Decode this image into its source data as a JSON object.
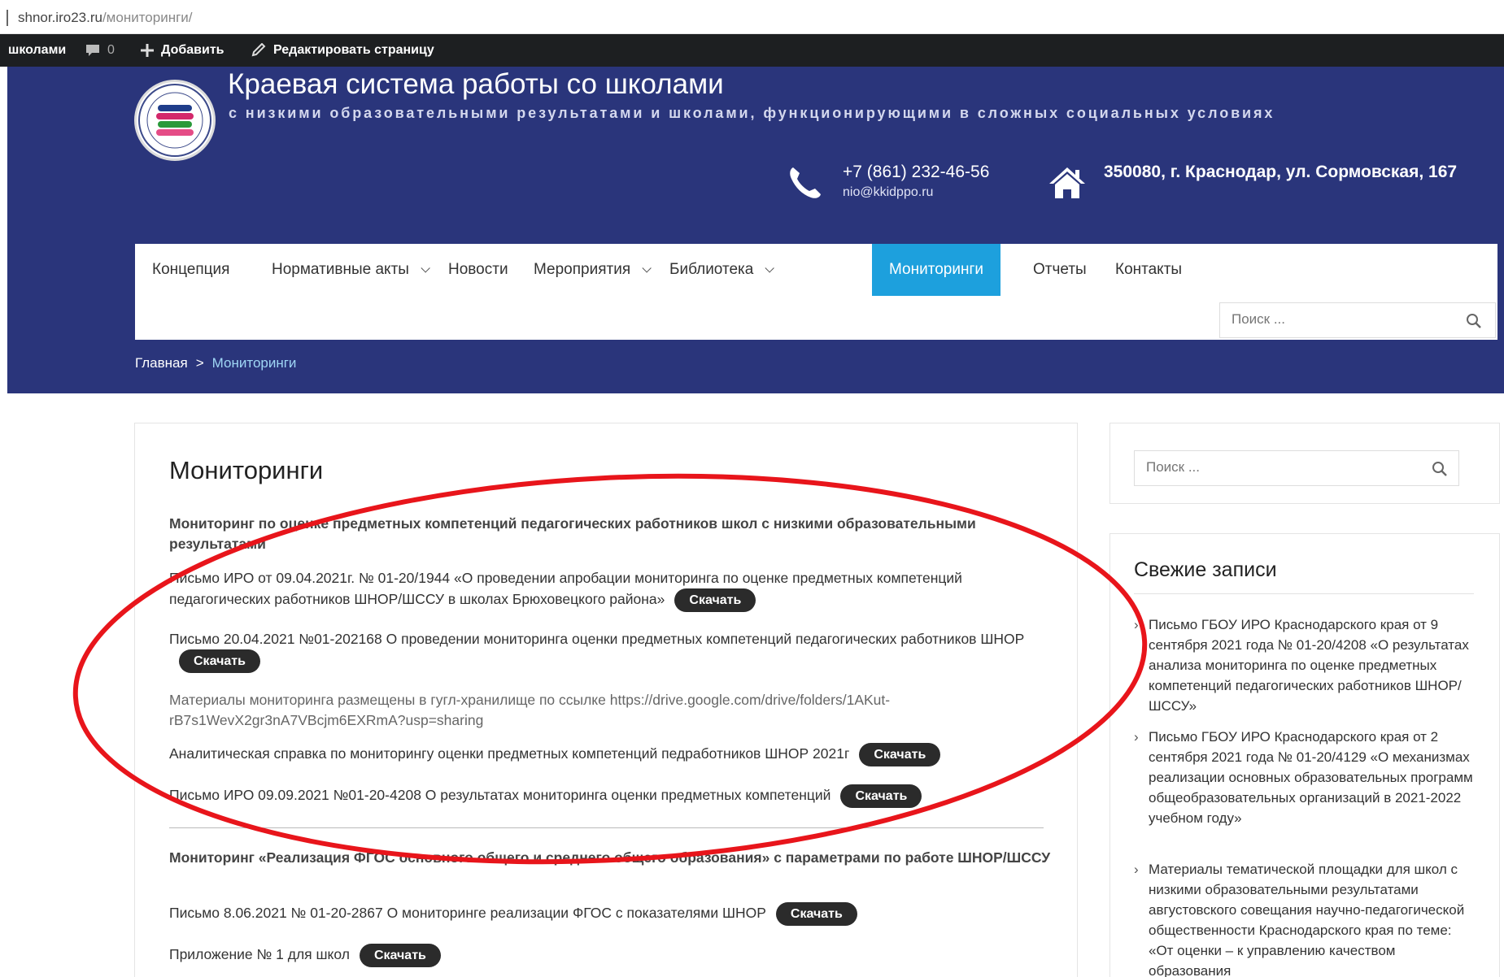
{
  "browser": {
    "url_host": "shnor.iro23.ru",
    "url_path": "/мониторинги/"
  },
  "admin_bar": {
    "site_link": "школами",
    "comments_count": "0",
    "add_label": "Добавить",
    "edit_label": "Редактировать страницу"
  },
  "header": {
    "title": "Краевая система работы со школами",
    "description": "с низкими образовательными результатами и школами, функционирующими в сложных социальных условиях",
    "phone": "+7 (861) 232-46-56",
    "email": "nio@kkidppo.ru",
    "address": "350080, г. Краснодар, ул. Сормовская, 167"
  },
  "nav": {
    "items": [
      {
        "label": "Концепция"
      },
      {
        "label": "Нормативные акты"
      },
      {
        "label": "Новости"
      },
      {
        "label": "Мероприятия"
      },
      {
        "label": "Библиотека"
      },
      {
        "label": "Мониторинги"
      },
      {
        "label": "Отчеты"
      },
      {
        "label": "Контакты"
      }
    ],
    "search_placeholder": "Поиск ..."
  },
  "breadcrumb": {
    "home": "Главная",
    "separator": ">",
    "current": "Мониторинги"
  },
  "main": {
    "title": "Мониторинги",
    "section1_heading": "Мониторинг по оценке предметных компетенций педагогических работников школ с низкими образовательными результатами",
    "items1": [
      "Письмо ИРО от 09.04.2021г. № 01-20/1944 «О проведении апробации мониторинга по оценке предметных компетенций педагогических работников ШНОР/ШССУ в школах Брюховецкого района»",
      "Письмо 20.04.2021 №01-202168 О проведении мониторинга оценки предметных компетенций педагогических работников ШНОР",
      "Материалы мониторинга размещены в гугл-хранилище по ссылке https://drive.google.com/drive/folders/1AKut-rB7s1WevX2gr3nA7VBcjm6EXRmA?usp=sharing",
      "Аналитическая справка по мониторингу оценки предметных компетенций педработников ШНОР 2021г",
      "Письмо ИРО 09.09.2021 №01-20-4208 О результатах мониторинга оценки предметных компетенций"
    ],
    "section2_heading": "Мониторинг «Реализация ФГОС основного общего и среднего общего образования» с параметрами по работе ШНОР/ШССУ",
    "items2": [
      "Письмо 8.06.2021 № 01-20-2867 О мониторинге реализации ФГОС с показателями ШНОР",
      "Приложение № 1 для школ"
    ],
    "download_label": "Скачать"
  },
  "sidebar": {
    "search_placeholder": "Поиск ...",
    "recent_title": "Свежие записи",
    "posts": [
      "Письмо ГБОУ ИРО Краснодарского края от 9 сентября 2021 года № 01-20/4208 «О результатах анализа мониторинга по оценке предметных компетенций педагогических работников ШНОР/ШССУ»",
      "Письмо ГБОУ ИРО Краснодарского края от 2 сентября 2021 года № 01-20/4129 «О механизмах реализации основных образовательных программ общеобразовательных организаций в 2021-2022 учебном году»",
      "Материалы тематической площадки для школ с низкими образовательными результатами августовского совещания научно-педагогической общественности Краснодарского края по теме: «От оценки – к управлению качеством образования"
    ]
  },
  "colors": {
    "header_bg": "#2a357b",
    "nav_active": "#1da0dd",
    "annotation": "#e8151b",
    "button_bg": "#2b2b2b"
  }
}
